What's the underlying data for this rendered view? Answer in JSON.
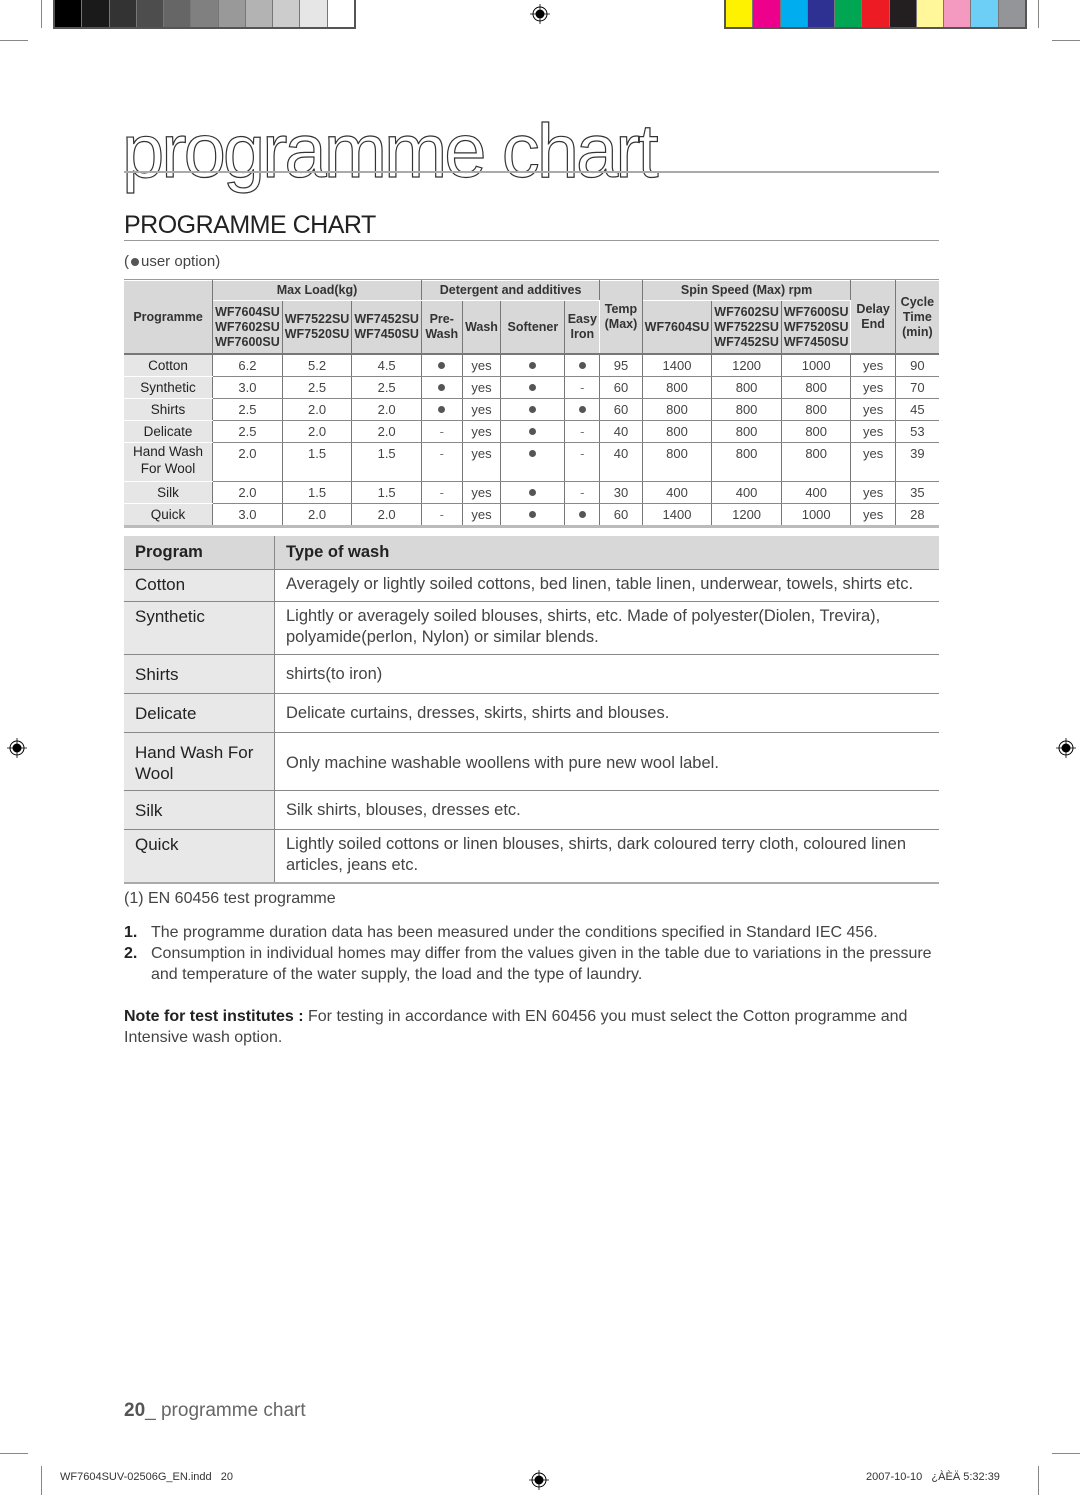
{
  "print_marks": {
    "gray_swatches": [
      "#000000",
      "#1a1a1a",
      "#333333",
      "#4d4d4d",
      "#666666",
      "#808080",
      "#999999",
      "#b3b3b3",
      "#cccccc",
      "#e6e6e6",
      "#ffffff"
    ],
    "color_swatches": [
      "#fff200",
      "#ec008c",
      "#00aeef",
      "#2e3192",
      "#00a651",
      "#ed1c24",
      "#231f20",
      "#fff799",
      "#f49ac1",
      "#6dcff6",
      "#939598"
    ]
  },
  "page": {
    "big_title": "programme chart",
    "section_title": "PROGRAMME CHART",
    "user_option_label": "user option"
  },
  "programme_table": {
    "headers": {
      "programme": "Programme",
      "max_load": "Max Load(kg)",
      "max_load_models": [
        "WF7604SU WF7602SU WF7600SU",
        "WF7522SU WF7520SU",
        "WF7452SU WF7450SU"
      ],
      "detergent": "Detergent and additives",
      "detergent_cols": [
        "Pre- Wash",
        "Wash",
        "Softener",
        "Easy Iron"
      ],
      "temp": "Temp (Max)",
      "spin": "Spin Speed (Max) rpm",
      "spin_models": [
        "WF7604SU",
        "WF7602SU WF7522SU WF7452SU",
        "WF7600SU WF7520SU WF7450SU"
      ],
      "delay_end": "Delay End",
      "cycle_time": "Cycle Time (min)"
    },
    "rows": [
      {
        "name": "Cotton",
        "load": [
          "6.2",
          "5.2",
          "4.5"
        ],
        "prewash": "●",
        "wash": "yes",
        "softener": "●",
        "easy_iron": "●",
        "temp": "95",
        "spin": [
          "1400",
          "1200",
          "1000"
        ],
        "delay_end": "yes",
        "cycle": "90"
      },
      {
        "name": "Synthetic",
        "load": [
          "3.0",
          "2.5",
          "2.5"
        ],
        "prewash": "●",
        "wash": "yes",
        "softener": "●",
        "easy_iron": "-",
        "temp": "60",
        "spin": [
          "800",
          "800",
          "800"
        ],
        "delay_end": "yes",
        "cycle": "70"
      },
      {
        "name": "Shirts",
        "load": [
          "2.5",
          "2.0",
          "2.0"
        ],
        "prewash": "●",
        "wash": "yes",
        "softener": "●",
        "easy_iron": "●",
        "temp": "60",
        "spin": [
          "800",
          "800",
          "800"
        ],
        "delay_end": "yes",
        "cycle": "45"
      },
      {
        "name": "Delicate",
        "load": [
          "2.5",
          "2.0",
          "2.0"
        ],
        "prewash": "-",
        "wash": "yes",
        "softener": "●",
        "easy_iron": "-",
        "temp": "40",
        "spin": [
          "800",
          "800",
          "800"
        ],
        "delay_end": "yes",
        "cycle": "53"
      },
      {
        "name": "Hand Wash For Wool",
        "load": [
          "2.0",
          "1.5",
          "1.5"
        ],
        "prewash": "-",
        "wash": "yes",
        "softener": "●",
        "easy_iron": "-",
        "temp": "40",
        "spin": [
          "800",
          "800",
          "800"
        ],
        "delay_end": "yes",
        "cycle": "39"
      },
      {
        "name": "Silk",
        "load": [
          "2.0",
          "1.5",
          "1.5"
        ],
        "prewash": "-",
        "wash": "yes",
        "softener": "●",
        "easy_iron": "-",
        "temp": "30",
        "spin": [
          "400",
          "400",
          "400"
        ],
        "delay_end": "yes",
        "cycle": "35"
      },
      {
        "name": "Quick",
        "load": [
          "3.0",
          "2.0",
          "2.0"
        ],
        "prewash": "-",
        "wash": "yes",
        "softener": "●",
        "easy_iron": "●",
        "temp": "60",
        "spin": [
          "1400",
          "1200",
          "1000"
        ],
        "delay_end": "yes",
        "cycle": "28"
      }
    ]
  },
  "wash_table": {
    "headers": [
      "Program",
      "Type of wash"
    ],
    "rows": [
      {
        "program": "Cotton",
        "description": "Averagely or lightly soiled cottons, bed linen, table linen, underwear, towels, shirts etc."
      },
      {
        "program": "Synthetic",
        "description": "Lightly or averagely soiled blouses, shirts, etc. Made of polyester(Diolen, Trevira), polyamide(perlon, Nylon) or similar blends."
      },
      {
        "program": "Shirts",
        "description": "shirts(to iron)"
      },
      {
        "program": "Delicate",
        "description": "Delicate curtains, dresses, skirts, shirts and blouses."
      },
      {
        "program": "Hand Wash For Wool",
        "description": "Only machine washable woollens with pure new wool label."
      },
      {
        "program": "Silk",
        "description": "Silk shirts, blouses, dresses etc."
      },
      {
        "program": "Quick",
        "description": "Lightly soiled cottons or linen blouses, shirts, dark coloured terry cloth, coloured linen articles, jeans etc."
      }
    ]
  },
  "footnote": "(1) EN 60456 test programme",
  "notes": [
    {
      "num": "1.",
      "text": "The programme duration data has been measured under the conditions specified in Standard IEC 456."
    },
    {
      "num": "2.",
      "text": "Consumption in individual homes may differ from the values given in the table due to variations in the pressure and temperature of the water supply, the load and the type of laundry."
    }
  ],
  "test_note": {
    "label": "Note for test institutes :",
    "text": " For testing in accordance with EN 60456 you must select the Cotton programme and Intensive wash option."
  },
  "footer": {
    "page_number": "20",
    "section": "_ programme chart",
    "slug_file": "WF7604SUV-02506G_EN.indd   20",
    "slug_date": "2007-10-10   ¿ÀÈÄ 5:32:39"
  }
}
